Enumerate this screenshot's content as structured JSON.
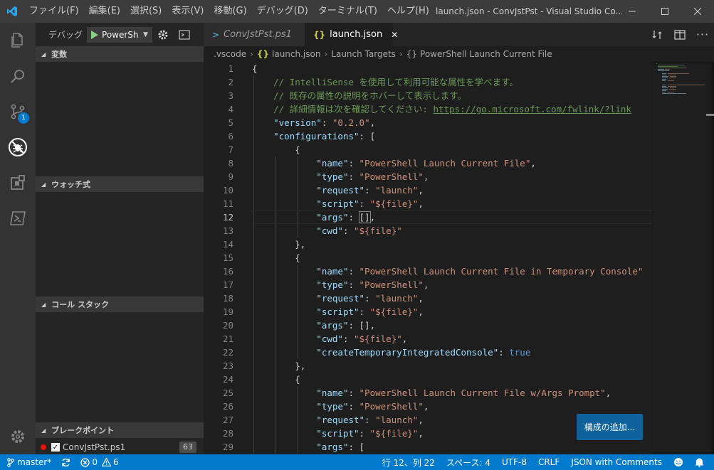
{
  "titlebar": {
    "menu": [
      "ファイル(F)",
      "編集(E)",
      "選択(S)",
      "表示(V)",
      "移動(G)",
      "デバッグ(D)",
      "ターミナル(T)",
      "ヘルプ(H)"
    ],
    "title": "launch.json - ConvJstPst - Visual Studio Co..."
  },
  "activity": {
    "scm_badge": "1"
  },
  "sidebar": {
    "debug_label": "デバッグ",
    "config_name": "PowerSh",
    "sections": {
      "variables": "変数",
      "watch": "ウォッチ式",
      "callstack": "コール スタック",
      "breakpoints": "ブレークポイント"
    },
    "breakpoint": {
      "file": "ConvJstPst.ps1",
      "count": "63"
    }
  },
  "tabs": [
    {
      "label": "ConvJstPst.ps1",
      "icon": ">"
    },
    {
      "label": "launch.json",
      "icon": "{}"
    }
  ],
  "breadcrumb": {
    "folder": ".vscode",
    "file": "launch.json",
    "item1": "Launch Targets",
    "item2": "PowerShell Launch Current File"
  },
  "editor": {
    "current_line": 12,
    "lines": [
      [
        [
          "{",
          "#d4d4d4"
        ]
      ],
      [
        [
          "    // IntelliSense を使用して利用可能な属性を学べます。",
          "#6a9955"
        ]
      ],
      [
        [
          "    // 既存の属性の説明をホバーして表示します。",
          "#6a9955"
        ]
      ],
      [
        [
          "    // 詳細情報は次を確認してください: ",
          "#6a9955"
        ],
        [
          "https://go.microsoft.com/fwlink/?link",
          "#6a9955"
        ]
      ],
      [
        [
          "    ",
          "#d4d4d4"
        ],
        [
          "\"version\"",
          "#9cdcfe"
        ],
        [
          ": ",
          "#d4d4d4"
        ],
        [
          "\"0.2.0\"",
          "#ce9178"
        ],
        [
          ",",
          "#d4d4d4"
        ]
      ],
      [
        [
          "    ",
          "#d4d4d4"
        ],
        [
          "\"configurations\"",
          "#9cdcfe"
        ],
        [
          ": [",
          "#d4d4d4"
        ]
      ],
      [
        [
          "        {",
          "#d4d4d4"
        ]
      ],
      [
        [
          "            ",
          "#d4d4d4"
        ],
        [
          "\"name\"",
          "#9cdcfe"
        ],
        [
          ": ",
          "#d4d4d4"
        ],
        [
          "\"PowerShell Launch Current File\"",
          "#ce9178"
        ],
        [
          ",",
          "#d4d4d4"
        ]
      ],
      [
        [
          "            ",
          "#d4d4d4"
        ],
        [
          "\"type\"",
          "#9cdcfe"
        ],
        [
          ": ",
          "#d4d4d4"
        ],
        [
          "\"PowerShell\"",
          "#ce9178"
        ],
        [
          ",",
          "#d4d4d4"
        ]
      ],
      [
        [
          "            ",
          "#d4d4d4"
        ],
        [
          "\"request\"",
          "#9cdcfe"
        ],
        [
          ": ",
          "#d4d4d4"
        ],
        [
          "\"launch\"",
          "#ce9178"
        ],
        [
          ",",
          "#d4d4d4"
        ]
      ],
      [
        [
          "            ",
          "#d4d4d4"
        ],
        [
          "\"script\"",
          "#9cdcfe"
        ],
        [
          ": ",
          "#d4d4d4"
        ],
        [
          "\"${file}\"",
          "#ce9178"
        ],
        [
          ",",
          "#d4d4d4"
        ]
      ],
      [
        [
          "            ",
          "#d4d4d4"
        ],
        [
          "\"args\"",
          "#9cdcfe"
        ],
        [
          ": ",
          "#d4d4d4"
        ],
        [
          "[]",
          "#d4d4d4"
        ],
        [
          ",",
          "#d4d4d4"
        ]
      ],
      [
        [
          "            ",
          "#d4d4d4"
        ],
        [
          "\"cwd\"",
          "#9cdcfe"
        ],
        [
          ": ",
          "#d4d4d4"
        ],
        [
          "\"${file}\"",
          "#ce9178"
        ]
      ],
      [
        [
          "        },",
          "#d4d4d4"
        ]
      ],
      [
        [
          "        {",
          "#d4d4d4"
        ]
      ],
      [
        [
          "            ",
          "#d4d4d4"
        ],
        [
          "\"name\"",
          "#9cdcfe"
        ],
        [
          ": ",
          "#d4d4d4"
        ],
        [
          "\"PowerShell Launch Current File in Temporary Console\"",
          "#ce9178"
        ]
      ],
      [
        [
          "            ",
          "#d4d4d4"
        ],
        [
          "\"type\"",
          "#9cdcfe"
        ],
        [
          ": ",
          "#d4d4d4"
        ],
        [
          "\"PowerShell\"",
          "#ce9178"
        ],
        [
          ",",
          "#d4d4d4"
        ]
      ],
      [
        [
          "            ",
          "#d4d4d4"
        ],
        [
          "\"request\"",
          "#9cdcfe"
        ],
        [
          ": ",
          "#d4d4d4"
        ],
        [
          "\"launch\"",
          "#ce9178"
        ],
        [
          ",",
          "#d4d4d4"
        ]
      ],
      [
        [
          "            ",
          "#d4d4d4"
        ],
        [
          "\"script\"",
          "#9cdcfe"
        ],
        [
          ": ",
          "#d4d4d4"
        ],
        [
          "\"${file}\"",
          "#ce9178"
        ],
        [
          ",",
          "#d4d4d4"
        ]
      ],
      [
        [
          "            ",
          "#d4d4d4"
        ],
        [
          "\"args\"",
          "#9cdcfe"
        ],
        [
          ": [],",
          "#d4d4d4"
        ]
      ],
      [
        [
          "            ",
          "#d4d4d4"
        ],
        [
          "\"cwd\"",
          "#9cdcfe"
        ],
        [
          ": ",
          "#d4d4d4"
        ],
        [
          "\"${file}\"",
          "#ce9178"
        ],
        [
          ",",
          "#d4d4d4"
        ]
      ],
      [
        [
          "            ",
          "#d4d4d4"
        ],
        [
          "\"createTemporaryIntegratedConsole\"",
          "#9cdcfe"
        ],
        [
          ": ",
          "#d4d4d4"
        ],
        [
          "true",
          "#569cd6"
        ]
      ],
      [
        [
          "        },",
          "#d4d4d4"
        ]
      ],
      [
        [
          "        {",
          "#d4d4d4"
        ]
      ],
      [
        [
          "            ",
          "#d4d4d4"
        ],
        [
          "\"name\"",
          "#9cdcfe"
        ],
        [
          ": ",
          "#d4d4d4"
        ],
        [
          "\"PowerShell Launch Current File w/Args Prompt\"",
          "#ce9178"
        ],
        [
          ",",
          "#d4d4d4"
        ]
      ],
      [
        [
          "            ",
          "#d4d4d4"
        ],
        [
          "\"type\"",
          "#9cdcfe"
        ],
        [
          ": ",
          "#d4d4d4"
        ],
        [
          "\"PowerShell\"",
          "#ce9178"
        ],
        [
          ",",
          "#d4d4d4"
        ]
      ],
      [
        [
          "            ",
          "#d4d4d4"
        ],
        [
          "\"request\"",
          "#9cdcfe"
        ],
        [
          ": ",
          "#d4d4d4"
        ],
        [
          "\"launch\"",
          "#ce9178"
        ],
        [
          ",",
          "#d4d4d4"
        ]
      ],
      [
        [
          "            ",
          "#d4d4d4"
        ],
        [
          "\"script\"",
          "#9cdcfe"
        ],
        [
          ": ",
          "#d4d4d4"
        ],
        [
          "\"${file}\"",
          "#ce9178"
        ],
        [
          ",",
          "#d4d4d4"
        ]
      ],
      [
        [
          "            ",
          "#d4d4d4"
        ],
        [
          "\"args\"",
          "#9cdcfe"
        ],
        [
          ": [",
          "#d4d4d4"
        ]
      ]
    ]
  },
  "add_config_button": "構成の追加...",
  "statusbar": {
    "branch": "master*",
    "errors": "0",
    "warnings": "6",
    "position": "行 12、列 22",
    "spaces": "スペース: 4",
    "encoding": "UTF-8",
    "eol": "CRLF",
    "language": "JSON with Comments"
  },
  "colors": {
    "accent": "#007acc",
    "button": "#0e639c",
    "breakpoint": "#e51400"
  }
}
